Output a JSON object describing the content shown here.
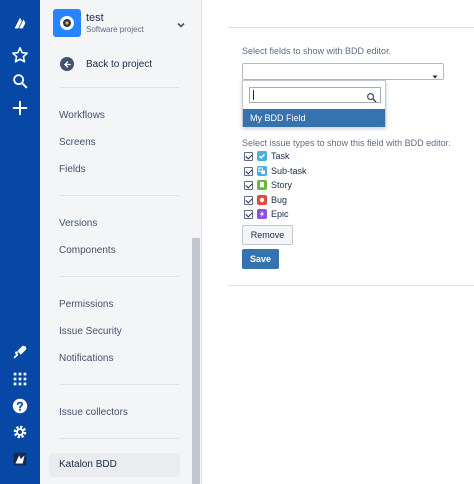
{
  "project": {
    "name": "test",
    "type": "Software project",
    "back_label": "Back to project"
  },
  "sidebar": {
    "items": [
      {
        "label": "Workflows"
      },
      {
        "label": "Screens"
      },
      {
        "label": "Fields"
      },
      {
        "label": "Versions"
      },
      {
        "label": "Components"
      },
      {
        "label": "Permissions"
      },
      {
        "label": "Issue Security"
      },
      {
        "label": "Notifications"
      },
      {
        "label": "Issue collectors"
      },
      {
        "label": "Katalon BDD",
        "active": true
      }
    ]
  },
  "main": {
    "select_fields_label": "Select fields to show with BDD editor.",
    "dropdown_search_value": "",
    "dropdown_option": "My BDD Field",
    "select_issue_types_label": "Select issue types to show this field with BDD editor.",
    "issue_types": [
      {
        "label": "Task",
        "checked": true,
        "color": "#4bade8",
        "icon": "task-icon"
      },
      {
        "label": "Sub-task",
        "checked": true,
        "color": "#4bade8",
        "icon": "subtask-icon"
      },
      {
        "label": "Story",
        "checked": true,
        "color": "#63ba3c",
        "icon": "story-icon"
      },
      {
        "label": "Bug",
        "checked": true,
        "color": "#e5493a",
        "icon": "bug-icon"
      },
      {
        "label": "Epic",
        "checked": true,
        "color": "#904ee2",
        "icon": "epic-icon"
      }
    ],
    "remove_label": "Remove",
    "save_label": "Save"
  },
  "colors": {
    "global_nav": "#0747a6",
    "primary": "#3572b0",
    "sidebar_bg": "#f4f5f7"
  }
}
